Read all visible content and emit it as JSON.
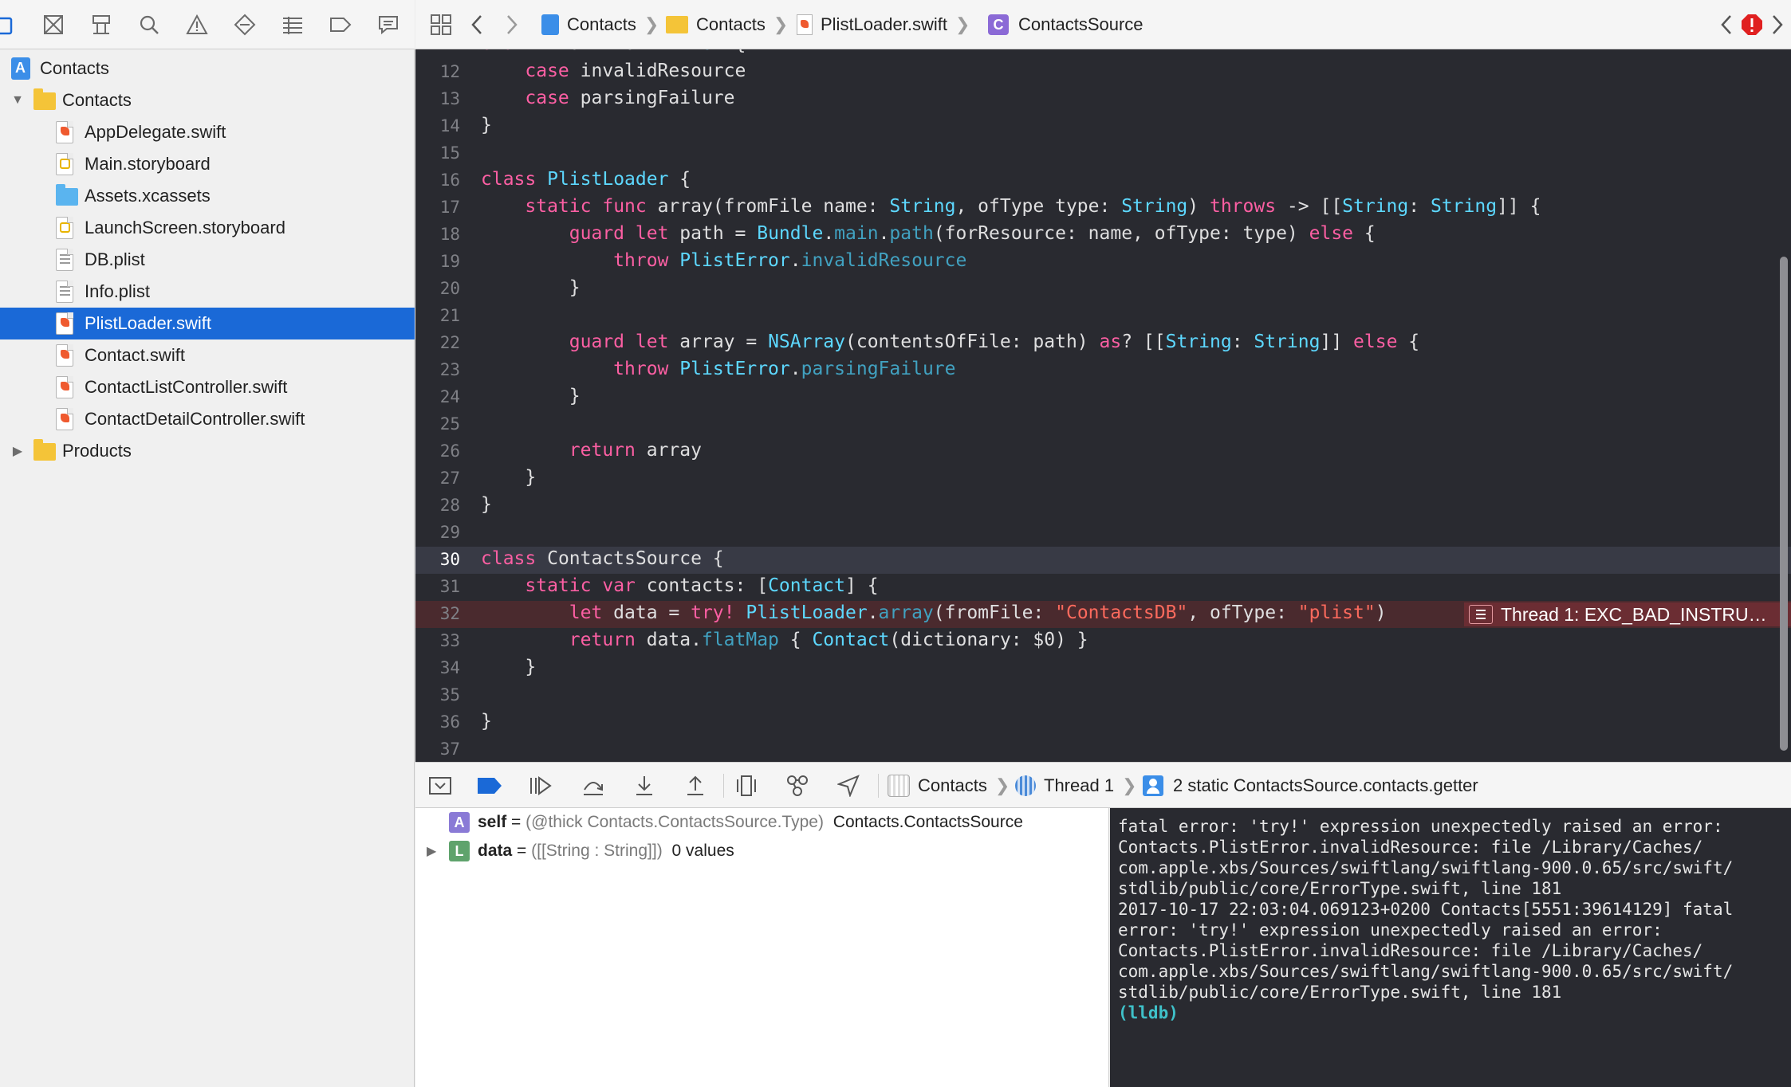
{
  "navigator": {
    "toolbar_icons": [
      "folder-icon",
      "source-control-icon",
      "symbol-icon",
      "search-icon",
      "issue-warning-icon",
      "test-icon",
      "debug-icon",
      "breakpoint-icon",
      "report-icon"
    ],
    "tree": [
      {
        "label": "Contacts",
        "kind": "project",
        "level": 0,
        "disclosure": "open"
      },
      {
        "label": "Contacts",
        "kind": "folder",
        "level": 1,
        "disclosure": "open"
      },
      {
        "label": "AppDelegate.swift",
        "kind": "swift",
        "level": 2
      },
      {
        "label": "Main.storyboard",
        "kind": "storyboard",
        "level": 2
      },
      {
        "label": "Assets.xcassets",
        "kind": "assets",
        "level": 2
      },
      {
        "label": "LaunchScreen.storyboard",
        "kind": "storyboard",
        "level": 2
      },
      {
        "label": "DB.plist",
        "kind": "plist",
        "level": 2
      },
      {
        "label": "Info.plist",
        "kind": "plist",
        "level": 2
      },
      {
        "label": "PlistLoader.swift",
        "kind": "swift",
        "level": 2,
        "selected": true
      },
      {
        "label": "Contact.swift",
        "kind": "swift",
        "level": 2
      },
      {
        "label": "ContactListController.swift",
        "kind": "swift",
        "level": 2
      },
      {
        "label": "ContactDetailController.swift",
        "kind": "swift",
        "level": 2
      },
      {
        "label": "Products",
        "kind": "folder",
        "level": 1,
        "disclosure": "closed"
      }
    ]
  },
  "jumpbar": {
    "crumbs": [
      "Contacts",
      "Contacts",
      "PlistLoader.swift",
      "ContactsSource"
    ]
  },
  "editor": {
    "current_line": 30,
    "error_line": 32,
    "error_message": "Thread 1: EXC_BAD_INSTRU…",
    "top_partial": "enum PlistError: Error {",
    "lines": [
      {
        "n": 12,
        "code": "    case invalidResource"
      },
      {
        "n": 13,
        "code": "    case parsingFailure"
      },
      {
        "n": 14,
        "code": "}"
      },
      {
        "n": 15,
        "code": ""
      },
      {
        "n": 16,
        "code": "class PlistLoader {"
      },
      {
        "n": 17,
        "code": "    static func array(fromFile name: String, ofType type: String) throws -> [[String: String]] {"
      },
      {
        "n": 18,
        "code": "        guard let path = Bundle.main.path(forResource: name, ofType: type) else {"
      },
      {
        "n": 19,
        "code": "            throw PlistError.invalidResource"
      },
      {
        "n": 20,
        "code": "        }"
      },
      {
        "n": 21,
        "code": ""
      },
      {
        "n": 22,
        "code": "        guard let array = NSArray(contentsOfFile: path) as? [[String: String]] else {"
      },
      {
        "n": 23,
        "code": "            throw PlistError.parsingFailure"
      },
      {
        "n": 24,
        "code": "        }"
      },
      {
        "n": 25,
        "code": ""
      },
      {
        "n": 26,
        "code": "        return array"
      },
      {
        "n": 27,
        "code": "    }"
      },
      {
        "n": 28,
        "code": "}"
      },
      {
        "n": 29,
        "code": ""
      },
      {
        "n": 30,
        "code": "class ContactsSource {"
      },
      {
        "n": 31,
        "code": "    static var contacts: [Contact] {"
      },
      {
        "n": 32,
        "code": "        let data = try! PlistLoader.array(fromFile: \"ContactsDB\", ofType: \"plist\")"
      },
      {
        "n": 33,
        "code": "        return data.flatMap { Contact(dictionary: $0) }"
      },
      {
        "n": 34,
        "code": "    }"
      },
      {
        "n": 35,
        "code": ""
      },
      {
        "n": 36,
        "code": "}"
      },
      {
        "n": 37,
        "code": ""
      }
    ]
  },
  "debugbar": {
    "crumbs": [
      "Contacts",
      "Thread 1",
      "2 static ContactsSource.contacts.getter"
    ]
  },
  "variables": [
    {
      "badge": "A",
      "name": "self",
      "type": "(@thick Contacts.ContactsSource.Type)",
      "value": "Contacts.ContactsSource",
      "expandable": false
    },
    {
      "badge": "L",
      "name": "data",
      "type": "([[String : String]])",
      "value": "0 values",
      "expandable": true
    }
  ],
  "console": {
    "lines": [
      "fatal error: 'try!' expression unexpectedly raised an error:",
      "Contacts.PlistError.invalidResource: file /Library/Caches/",
      "com.apple.xbs/Sources/swiftlang/swiftlang-900.0.65/src/swift/",
      "stdlib/public/core/ErrorType.swift, line 181",
      "2017-10-17 22:03:04.069123+0200 Contacts[5551:39614129] fatal",
      "error: 'try!' expression unexpectedly raised an error:",
      "Contacts.PlistError.invalidResource: file /Library/Caches/",
      "com.apple.xbs/Sources/swiftlang/swiftlang-900.0.65/src/swift/",
      "stdlib/public/core/ErrorType.swift, line 181"
    ],
    "prompt": "(lldb)"
  },
  "colors": {
    "selection": "#1a69d7",
    "editor_bg": "#292a30",
    "keyword": "#fc5fa3",
    "type": "#5dd8ff",
    "string": "#fc6a5d",
    "error_bg": "#4a2a2e",
    "error_badge": "#6b2d33",
    "console_prompt": "#3fc1c9"
  }
}
